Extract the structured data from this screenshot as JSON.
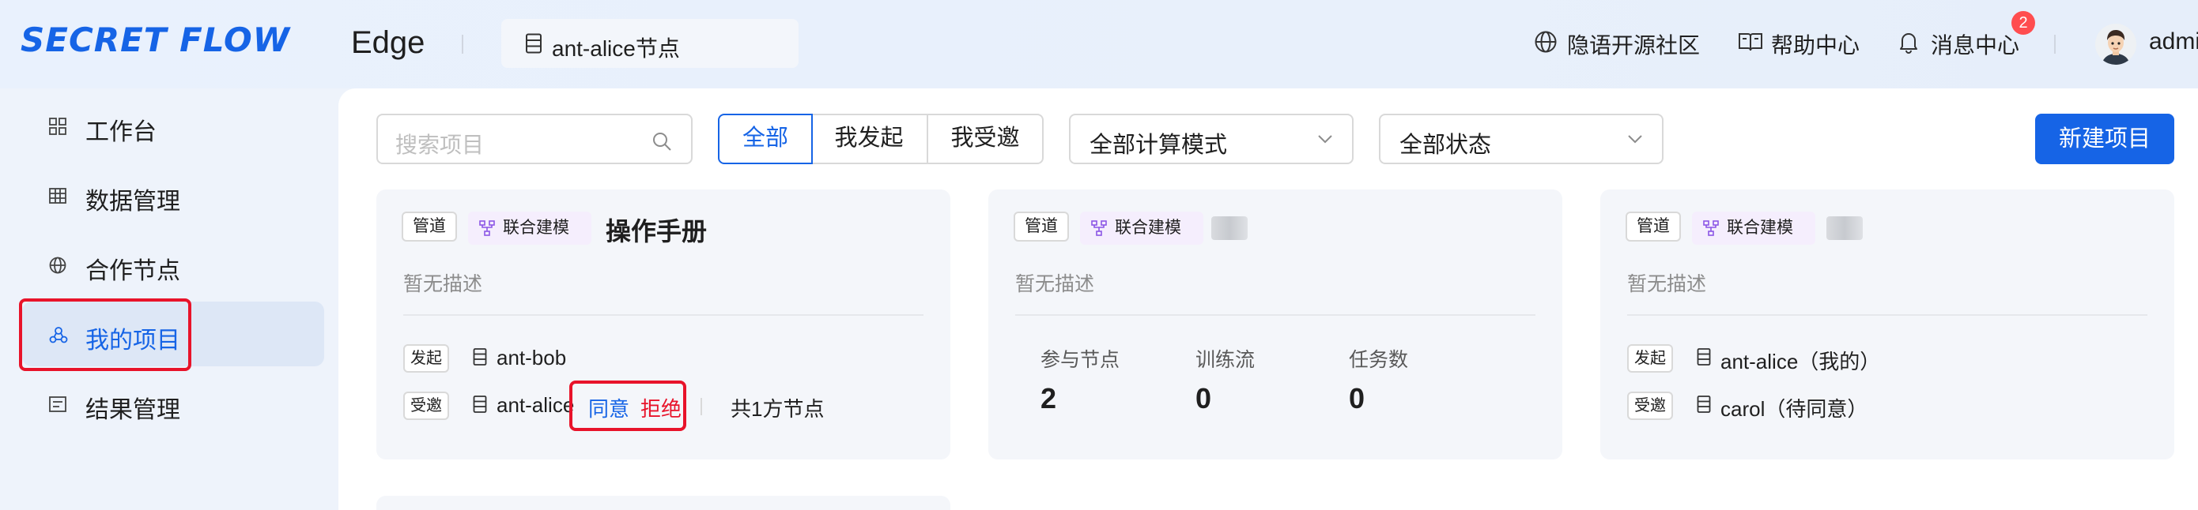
{
  "header": {
    "logo": "SECRET FLOW",
    "app_name": "Edge",
    "node_selector": "ant-alice节点",
    "community": "隐语开源社区",
    "help": "帮助中心",
    "messages": "消息中心",
    "message_count": "2",
    "user": "admi"
  },
  "sidebar": {
    "items": [
      {
        "label": "工作台",
        "icon": "grid-icon"
      },
      {
        "label": "数据管理",
        "icon": "table-icon"
      },
      {
        "label": "合作节点",
        "icon": "globe-icon"
      },
      {
        "label": "我的项目",
        "icon": "project-icon",
        "active": true
      },
      {
        "label": "结果管理",
        "icon": "list-icon"
      }
    ]
  },
  "toolbar": {
    "search_placeholder": "搜索项目",
    "filters": [
      "全部",
      "我发起",
      "我受邀"
    ],
    "active_filter": "全部",
    "compute_mode": "全部计算模式",
    "status": "全部状态",
    "new_project": "新建项目"
  },
  "cards": [
    {
      "tag_type": "管道",
      "tag_mode": "联合建模",
      "title": "操作手册",
      "description": "暂无描述",
      "initiator_label": "发起",
      "initiator": "ant-bob",
      "invitee_label": "受邀",
      "invitee": "ant-alice",
      "agree": "同意",
      "reject": "拒绝",
      "node_count": "共1方节点"
    },
    {
      "tag_type": "管道",
      "tag_mode": "联合建模",
      "description": "暂无描述",
      "stats": [
        {
          "label": "参与节点",
          "value": "2"
        },
        {
          "label": "训练流",
          "value": "0"
        },
        {
          "label": "任务数",
          "value": "0"
        }
      ]
    },
    {
      "tag_type": "管道",
      "tag_mode": "联合建模",
      "description": "暂无描述",
      "initiator_label": "发起",
      "initiator": "ant-alice（我的）",
      "invitee_label": "受邀",
      "invitee": "carol（待同意）"
    }
  ],
  "colors": {
    "primary": "#1664e6",
    "reject": "#e8132a",
    "highlight_box": "#e8132a",
    "badge": "#ff4d4f"
  }
}
